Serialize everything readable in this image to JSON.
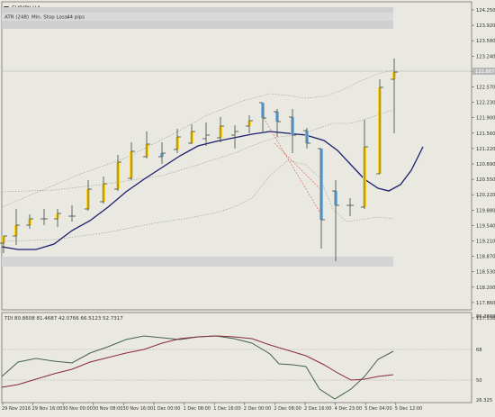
{
  "window": {
    "title": "EURJPY,H4",
    "menu_icon": "triangle-down-icon"
  },
  "indicators": {
    "atr_label": "ATR (248)",
    "stop_label": "Min. Stop Loss:",
    "stop_value": "44 pips"
  },
  "price_axis": {
    "labels": [
      "124.250",
      "123.920",
      "123.580",
      "123.240",
      "122.910",
      "122.570",
      "122.230",
      "121.900",
      "121.560",
      "121.220",
      "120.890",
      "120.550",
      "120.220",
      "119.880",
      "119.540",
      "119.210",
      "118.870",
      "118.530",
      "118.200",
      "117.860",
      "117.530"
    ],
    "current_price": "122.887",
    "current_price_bg": "#b9b9b9"
  },
  "oscillator": {
    "label": "TDI",
    "values_text": "80.8608 81.4687 42.0766 66.5123 52.7317",
    "axis_labels": [
      "86.3888",
      "68",
      "50",
      "26.325"
    ],
    "line_green": "#44644a",
    "line_red": "#8a2b3a"
  },
  "time_axis": {
    "labels": [
      "29 Nov 2016",
      "29 Nov 16:00",
      "30 Nov 00:00",
      "30 Nov 08:00",
      "30 Nov 16:00",
      "1 Dec 00:00",
      "1 Dec 08:00",
      "1 Dec 16:00",
      "2 Dec 00:00",
      "2 Dec 08:00",
      "2 Dec 16:00",
      "4 Dec 23:00",
      "5 Dec 04:00",
      "5 Dec 12:00"
    ]
  },
  "colors": {
    "background": "#e9e8e1",
    "up_candle": "#ffd42a",
    "down_candle": "#7db8e8",
    "bar_stroke": "#3a4a38",
    "ma_line": "#1a1f6e",
    "band": "#9a9a9a",
    "zone": "#d4d4d4"
  }
}
